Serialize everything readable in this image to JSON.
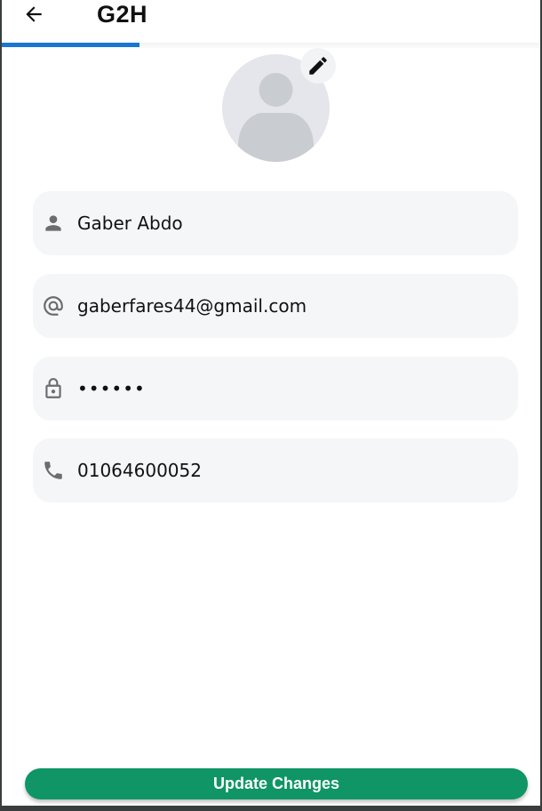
{
  "appbar": {
    "title": "G2H",
    "back_icon": "arrow-left-icon",
    "indicator_color": "#1976d2"
  },
  "profile": {
    "avatar_icon": "person-silhouette-icon",
    "edit_icon": "pencil-icon"
  },
  "fields": [
    {
      "icon": "person-icon",
      "value": "Gaber Abdo"
    },
    {
      "icon": "at-sign-icon",
      "value": "gaberfares44@gmail.com"
    },
    {
      "icon": "lock-icon",
      "value": "••••••"
    },
    {
      "icon": "phone-icon",
      "value": "01064600052"
    }
  ],
  "actions": {
    "update_label": "Update Changes",
    "update_color": "#0f9566"
  }
}
